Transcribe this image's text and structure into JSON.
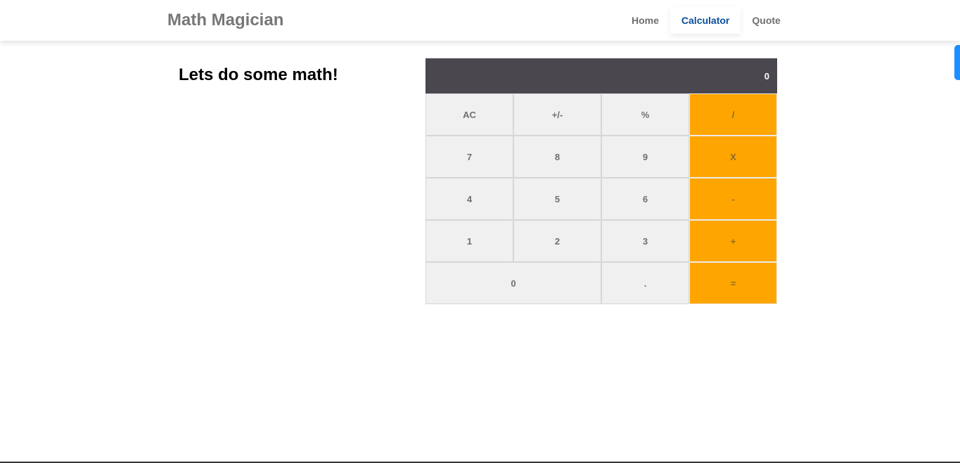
{
  "navbar": {
    "brand": "Math Magician",
    "links": [
      {
        "label": "Home"
      },
      {
        "label": "Calculator",
        "active": true
      },
      {
        "label": "Quote"
      }
    ]
  },
  "main": {
    "heading": "Lets do some math!"
  },
  "calculator": {
    "display": "0",
    "keys": [
      "AC",
      "+/-",
      "%",
      "/",
      "7",
      "8",
      "9",
      "X",
      "4",
      "5",
      "6",
      "-",
      "1",
      "2",
      "3",
      "+",
      "0",
      ".",
      "="
    ]
  },
  "colors": {
    "display_bg": "#4a474f",
    "operator_bg": "#ffa500",
    "key_bg": "#f0f0f0",
    "active_link": "#0a4f9a",
    "side_tab": "#1f8fff"
  }
}
